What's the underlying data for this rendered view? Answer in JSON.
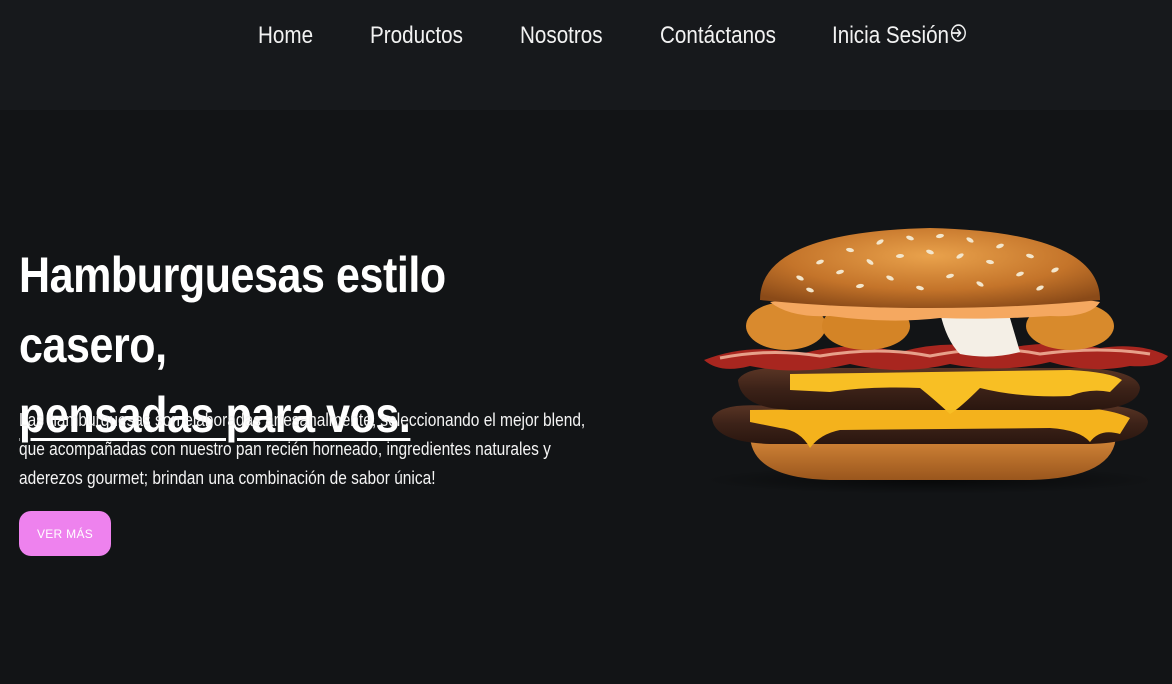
{
  "nav": {
    "items": [
      {
        "label": "Home"
      },
      {
        "label": "Productos"
      },
      {
        "label": "Nosotros"
      },
      {
        "label": "Contáctanos"
      },
      {
        "label": "Inicia Sesión",
        "icon": "login-icon"
      }
    ]
  },
  "hero": {
    "title_line1": "Hamburguesas estilo casero,",
    "title_line2": "pensadas para vos.",
    "description": "Las hamburguesas son elaboradas artesanalmente, seleccionando el mejor blend, que acompañadas con nuestro pan recién horneado, ingredientes naturales y aderezos gourmet; brindan una combinación de sabor única!",
    "cta_label": "VER MÁS",
    "image": "burger-image"
  },
  "colors": {
    "background": "#121416",
    "navbar": "#17191c",
    "accent": "#ee82ee",
    "text": "#ffffff"
  }
}
